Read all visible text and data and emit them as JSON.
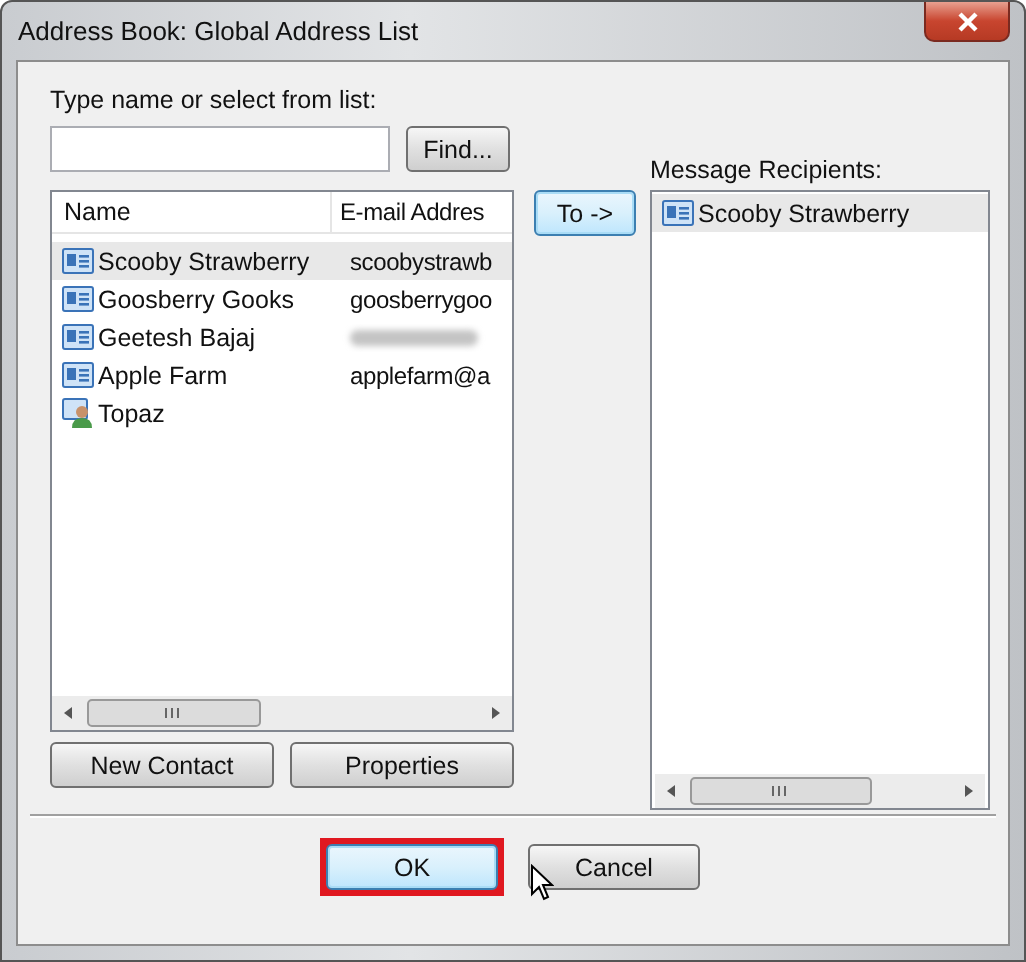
{
  "window": {
    "title": "Address Book: Global Address List"
  },
  "search": {
    "label": "Type name or select from list:",
    "find_button": "Find..."
  },
  "contacts": {
    "columns": [
      "Name",
      "E-mail Addres"
    ],
    "rows": [
      {
        "kind": "contact",
        "name": "Scooby Strawberry",
        "email": "scoobystrawb",
        "blurred": false,
        "selected": true
      },
      {
        "kind": "contact",
        "name": "Goosberry Gooks",
        "email": "goosberrygoo",
        "blurred": false,
        "selected": false
      },
      {
        "kind": "contact",
        "name": "Geetesh Bajaj",
        "blurred": true,
        "selected": false
      },
      {
        "kind": "contact",
        "name": "Apple Farm",
        "email": "applefarm@a",
        "blurred": false,
        "selected": false
      },
      {
        "kind": "group",
        "name": "Topaz",
        "blurred": false,
        "selected": false
      }
    ]
  },
  "to_button": "To ->",
  "recipients": {
    "label": "Message Recipients:",
    "items": [
      {
        "kind": "contact",
        "name": "Scooby Strawberry",
        "selected": true
      }
    ]
  },
  "list_buttons": [
    "New Contact",
    "Properties"
  ],
  "dialog_buttons": [
    {
      "label": "OK",
      "default": true,
      "highlighted": true
    },
    {
      "label": "Cancel",
      "default": false,
      "highlighted": false
    }
  ]
}
